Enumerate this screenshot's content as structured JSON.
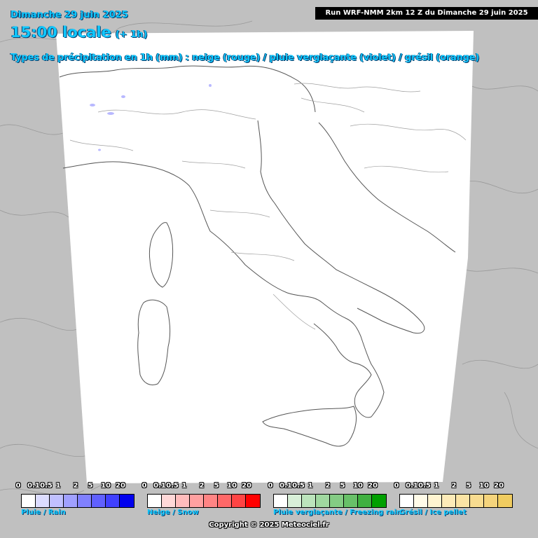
{
  "header": {
    "date": "Dimanche 29 juin 2025",
    "time": "15:00 locale",
    "time_offset": "(+ 1h)",
    "subtitle": "Types de précipitation en 1h (mm) : neige (rouge) / pluie verglaçante (violet) / grésil (orange)",
    "run_info": "Run WRF-NMM 2km 12 Z du Dimanche 29 juin 2025"
  },
  "colors": {
    "background": "#c0c0c0",
    "domain": "#ffffff",
    "borders": "#7a7a7a",
    "title_text": "#10c8ff"
  },
  "legends": [
    {
      "label": "Pluie / Rain",
      "ticks": [
        "0",
        "0.1",
        "0.5",
        "1",
        "2",
        "5",
        "10",
        "20"
      ],
      "colors": [
        "#ffffff",
        "#dcdcff",
        "#c0c0ff",
        "#a0a0ff",
        "#8080ff",
        "#6060ff",
        "#4040ff",
        "#0000ee"
      ]
    },
    {
      "label": "Neige / Snow",
      "ticks": [
        "0",
        "0.1",
        "0.5",
        "1",
        "2",
        "5",
        "10",
        "20"
      ],
      "colors": [
        "#ffffff",
        "#ffd8d8",
        "#ffbcbc",
        "#ffa0a0",
        "#ff8484",
        "#ff6868",
        "#ff4444",
        "#ff0000"
      ]
    },
    {
      "label": "Pluie verglaçante / Freezing rain",
      "ticks": [
        "0",
        "0.1",
        "0.5",
        "1",
        "2",
        "5",
        "10",
        "20"
      ],
      "colors": [
        "#ffffff",
        "#d8f0d8",
        "#bce4bc",
        "#a0d8a0",
        "#84cc84",
        "#68c068",
        "#40b040",
        "#00a000"
      ]
    },
    {
      "label": "Grésil / Ice pellet",
      "ticks": [
        "0",
        "0.1",
        "0.5",
        "1",
        "2",
        "5",
        "10",
        "20"
      ],
      "colors": [
        "#ffffff",
        "#fffbe8",
        "#fff4d0",
        "#fdebb8",
        "#fbe4a4",
        "#f8dc90",
        "#f5d47c",
        "#f0cc60"
      ]
    }
  ],
  "copyright": "Copyright © 2025 Meteociel.fr"
}
